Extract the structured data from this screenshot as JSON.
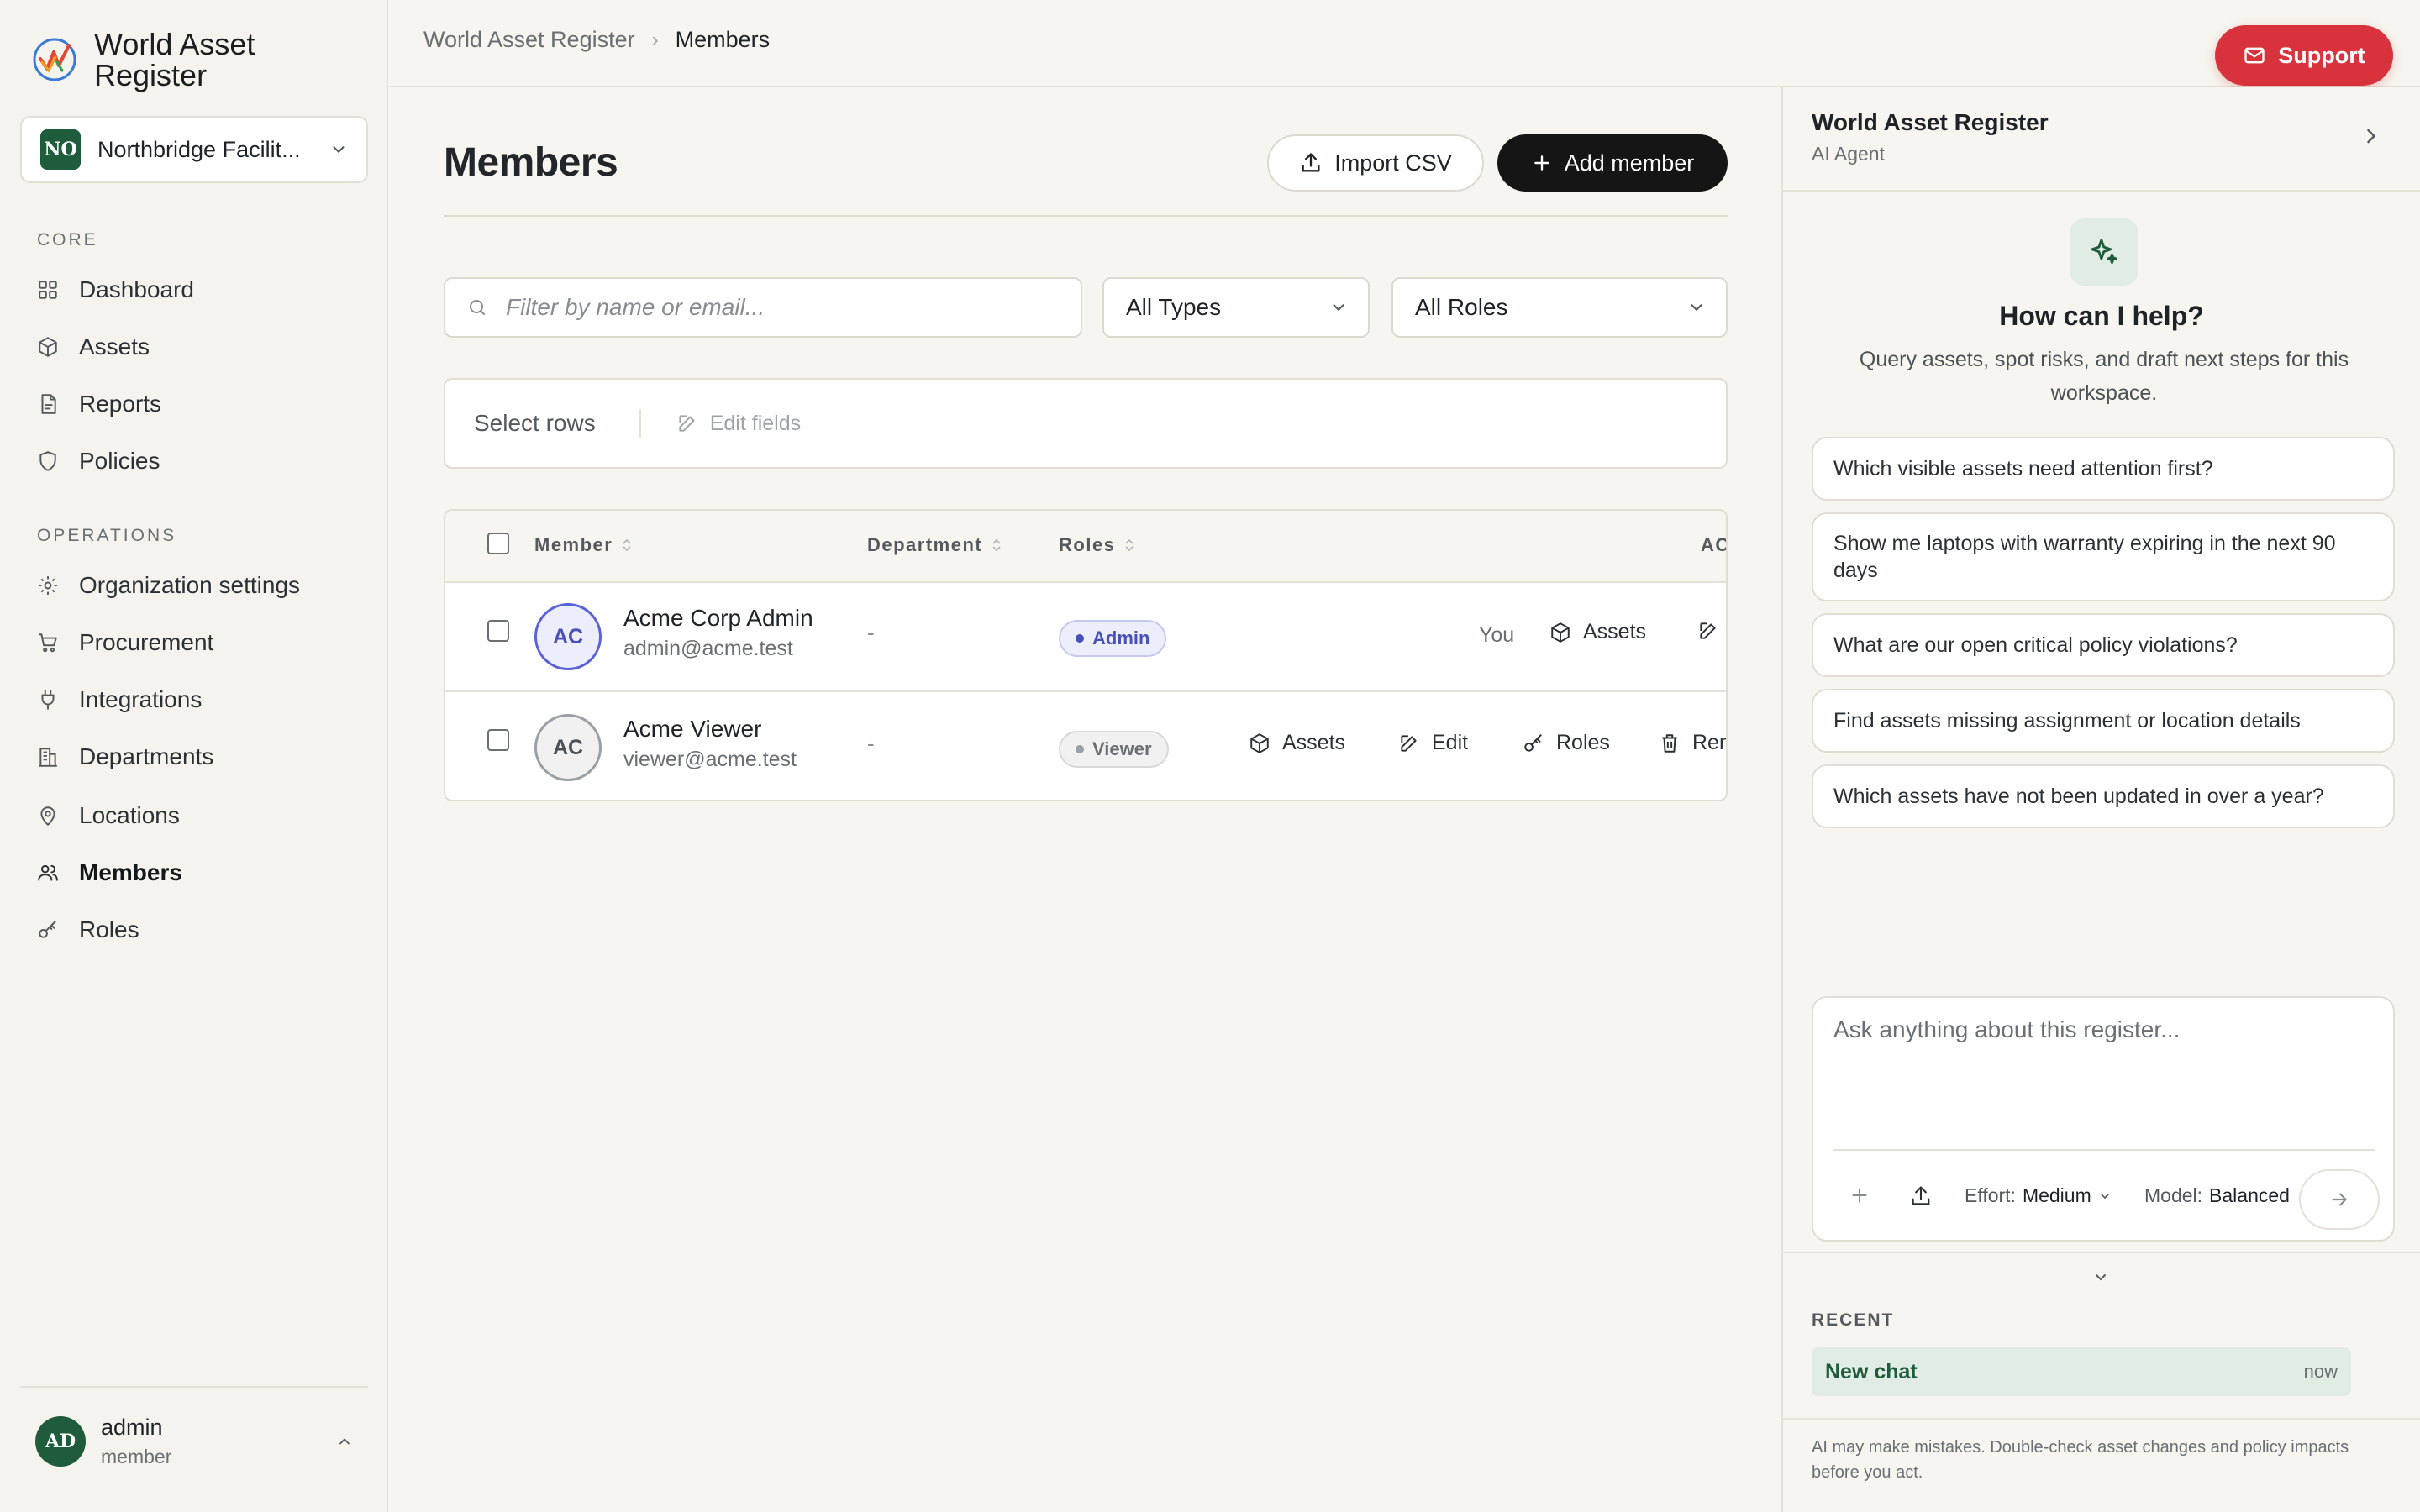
{
  "brand": {
    "name": "World Asset Register"
  },
  "org": {
    "badge": "NO",
    "name": "Northbridge Facilit..."
  },
  "nav": {
    "core_label": "CORE",
    "core": [
      {
        "label": "Dashboard",
        "icon": "grid-icon"
      },
      {
        "label": "Assets",
        "icon": "box-icon"
      },
      {
        "label": "Reports",
        "icon": "file-icon"
      },
      {
        "label": "Policies",
        "icon": "shield-icon"
      }
    ],
    "ops_label": "OPERATIONS",
    "ops": [
      {
        "label": "Organization settings",
        "icon": "gear-icon"
      },
      {
        "label": "Procurement",
        "icon": "cart-icon"
      },
      {
        "label": "Integrations",
        "icon": "plug-icon"
      },
      {
        "label": "Departments",
        "icon": "building-icon"
      },
      {
        "label": "Locations",
        "icon": "pin-icon"
      },
      {
        "label": "Members",
        "icon": "users-icon",
        "active": true
      },
      {
        "label": "Roles",
        "icon": "key-icon"
      }
    ]
  },
  "user": {
    "initials": "AD",
    "name": "admin",
    "role": "member"
  },
  "breadcrumb": {
    "root": "World Asset Register",
    "sep": "›",
    "current": "Members"
  },
  "support": {
    "label": "Support"
  },
  "page": {
    "title": "Members",
    "import_label": "Import CSV",
    "add_label": "Add member"
  },
  "filters": {
    "search_placeholder": "Filter by name or email...",
    "type_value": "All Types",
    "role_value": "All Roles"
  },
  "bulk": {
    "select_rows": "Select rows",
    "edit_fields": "Edit fields"
  },
  "table": {
    "columns": {
      "member": "Member",
      "department": "Department",
      "roles": "Roles",
      "actions": "AC"
    },
    "rows": [
      {
        "initials": "AC",
        "name": "Acme Corp Admin",
        "email": "admin@acme.test",
        "department": "-",
        "role": "Admin",
        "you": "You",
        "actions": [
          "Assets"
        ]
      },
      {
        "initials": "AC",
        "name": "Acme Viewer",
        "email": "viewer@acme.test",
        "department": "-",
        "role": "Viewer",
        "actions": [
          "Assets",
          "Edit",
          "Roles",
          "Ren"
        ]
      }
    ]
  },
  "agent": {
    "title": "World Asset Register",
    "subtitle": "AI Agent",
    "help_title": "How can I help?",
    "help_sub": "Query assets, spot risks, and draft next steps for this workspace.",
    "suggestions": [
      "Which visible assets need attention first?",
      "Show me laptops with warranty expiring in the next 90 days",
      "What are our open critical policy violations?",
      "Find assets missing assignment or location details",
      "Which assets have not been updated in over a year?"
    ],
    "composer_placeholder": "Ask anything about this register...",
    "effort_label": "Effort:",
    "effort_value": "Medium",
    "model_label": "Model:",
    "model_value": "Balanced",
    "recent_label": "RECENT",
    "recent": [
      {
        "title": "New chat",
        "time": "now"
      }
    ],
    "disclaimer": "AI may make mistakes. Double-check asset changes and policy impacts before you act."
  },
  "colors": {
    "accent_green": "#1f5c3c",
    "support_red": "#d8333c",
    "admin_indigo": "#4a50b8"
  }
}
